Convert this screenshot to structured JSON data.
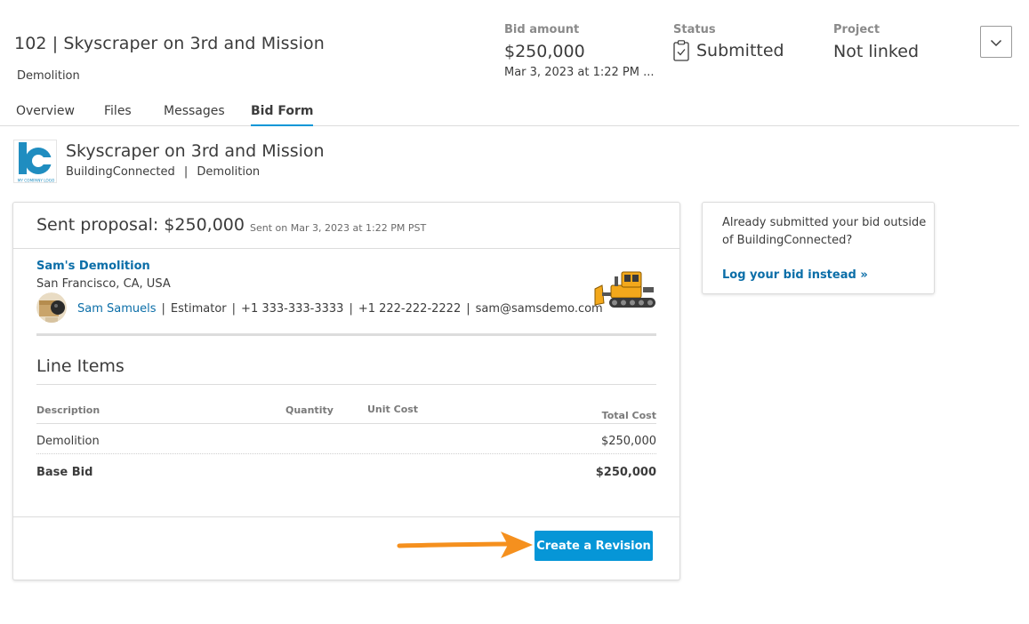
{
  "header": {
    "title": "102 | Skyscraper on 3rd and Mission",
    "subtitle": "Demolition",
    "bid_amount": {
      "label": "Bid amount",
      "value": "$250,000",
      "date": "Mar 3, 2023 at 1:22 PM ..."
    },
    "status": {
      "label": "Status",
      "value": "Submitted",
      "icon": "clipboard-check-icon"
    },
    "project": {
      "label": "Project",
      "value": "Not linked"
    },
    "menu_icon": "chevron-down-icon"
  },
  "tabs": [
    {
      "label": "Overview",
      "active": false
    },
    {
      "label": "Files",
      "active": false
    },
    {
      "label": "Messages",
      "active": false
    },
    {
      "label": "Bid Form",
      "active": true
    }
  ],
  "project_info": {
    "logo_caption": "MY COMPANY LOGO",
    "name": "Skyscraper on 3rd and Mission",
    "company": "BuildingConnected",
    "trade": "Demolition",
    "separator": "|"
  },
  "proposal": {
    "title": "Sent proposal: $250,000",
    "sent_on": "Sent on Mar 3, 2023 at 1:22 PM PST",
    "bidder": {
      "company": "Sam's Demolition",
      "location": "San Francisco, CA, USA",
      "contact_name": "Sam Samuels",
      "role": "Estimator",
      "phone_1": "+1 333-333-3333",
      "phone_2": "+1 222-222-2222",
      "email": "sam@samsdemo.com",
      "separator": "|"
    },
    "line_items": {
      "title": "Line Items",
      "columns": [
        "Description",
        "Quantity",
        "Unit Cost",
        "Total Cost"
      ],
      "rows": [
        {
          "description": "Demolition",
          "quantity": "",
          "unit_cost": "",
          "total": "$250,000"
        }
      ],
      "base_bid": {
        "label": "Base Bid",
        "total": "$250,000"
      }
    },
    "revision_button": "Create a Revision"
  },
  "side_card": {
    "text": "Already submitted your bid outside of BuildingConnected?",
    "link": "Log your bid instead »"
  },
  "colors": {
    "accent": "#0696d7",
    "link": "#0b6ea8",
    "arrow": "#f5901e",
    "logo_blue": "#1f8dc0"
  }
}
